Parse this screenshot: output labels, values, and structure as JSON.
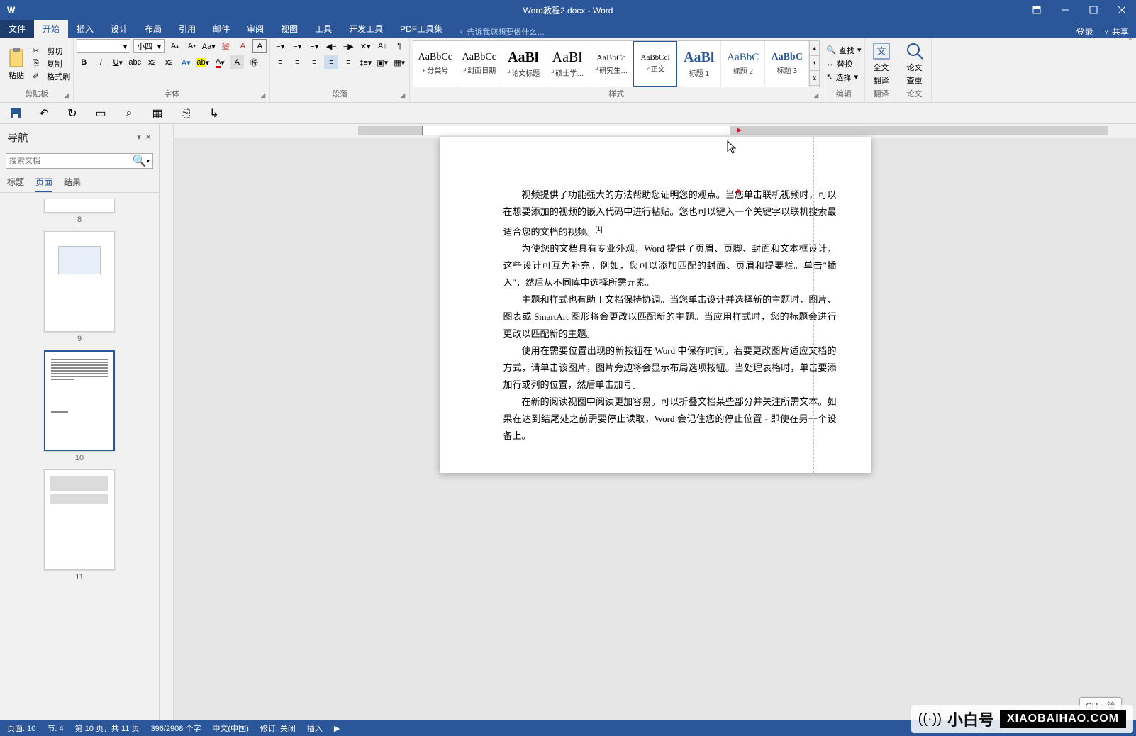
{
  "window": {
    "title": "Word教程2.docx - Word"
  },
  "titleControls": {
    "login": "登录",
    "share": "共享"
  },
  "tabs": {
    "file": "文件",
    "home": "开始",
    "insert": "插入",
    "design": "设计",
    "layout": "布局",
    "references": "引用",
    "mailings": "邮件",
    "review": "审阅",
    "view": "视图",
    "tools": "工具",
    "devtools": "开发工具",
    "pdftools": "PDF工具集",
    "tellme": "告诉我您想要做什么…"
  },
  "ribbon": {
    "clipboard": {
      "paste": "粘贴",
      "cut": "剪切",
      "copy": "复制",
      "formatPainter": "格式刷",
      "label": "剪贴板"
    },
    "font": {
      "name": "",
      "size": "小四",
      "label": "字体"
    },
    "paragraph": {
      "label": "段落"
    },
    "styles": {
      "label": "样式",
      "items": [
        {
          "preview": "AaBbCc",
          "label": "分类号",
          "arrow": true,
          "size": "14px"
        },
        {
          "preview": "AaBbCc",
          "label": "封面日期",
          "arrow": true,
          "size": "14px"
        },
        {
          "preview": "AaBl",
          "label": "论文标题",
          "arrow": true,
          "size": "20px",
          "bold": true
        },
        {
          "preview": "AaBl",
          "label": "硕士学…",
          "arrow": true,
          "size": "20px"
        },
        {
          "preview": "AaBbCc",
          "label": "研究生…",
          "arrow": true,
          "size": "12px"
        },
        {
          "preview": "AaBbCcI",
          "label": "正文",
          "arrow": true,
          "size": "11px",
          "selected": true
        },
        {
          "preview": "AaBl",
          "label": "标题 1",
          "arrow": false,
          "size": "20px",
          "bold": true,
          "color": "#2b579a"
        },
        {
          "preview": "AaBbC",
          "label": "标题 2",
          "arrow": false,
          "size": "15px",
          "color": "#2b579a"
        },
        {
          "preview": "AaBbC",
          "label": "标题 3",
          "arrow": false,
          "size": "14px",
          "bold": true,
          "color": "#2b579a"
        }
      ]
    },
    "editing": {
      "find": "查找",
      "replace": "替换",
      "select": "选择",
      "label": "编辑"
    },
    "translate": {
      "full": "全文",
      "line2": "翻译",
      "label": "翻译"
    },
    "duplicate": {
      "line1": "论文",
      "line2": "查重",
      "label": "论文"
    }
  },
  "nav": {
    "title": "导航",
    "searchPlaceholder": "搜索文档",
    "tabs": {
      "headings": "标题",
      "pages": "页面",
      "results": "结果"
    },
    "thumbs": [
      "8",
      "9",
      "10",
      "11"
    ]
  },
  "document": {
    "p1": "视频提供了功能强大的方法帮助您证明您的观点。当您单击联机视频时，可以在想要添加的视频的嵌入代码中进行粘贴。您也可以键入一个关键字以联机搜索最适合您的文档的视频。",
    "sup1": "[1]",
    "p2": "为使您的文档具有专业外观，Word 提供了页眉、页脚、封面和文本框设计，这些设计可互为补充。例如，您可以添加匹配的封面、页眉和提要栏。单击\"插入\"，然后从不同库中选择所需元素。",
    "p3": "主题和样式也有助于文档保持协调。当您单击设计并选择新的主题时，图片、图表或 SmartArt 图形将会更改以匹配新的主题。当应用样式时，您的标题会进行更改以匹配新的主题。",
    "p4": "使用在需要位置出现的新按钮在 Word 中保存时间。若要更改图片适应文档的方式，请单击该图片，图片旁边将会显示布局选项按钮。当处理表格时，单击要添加行或列的位置，然后单击加号。",
    "p5": "在新的阅读视图中阅读更加容易。可以折叠文档某些部分并关注所需文本。如果在达到结尾处之前需要停止读取，Word 会记住您的停止位置 - 即使在另一个设备上。"
  },
  "ime": {
    "text": "CH ♪ 简"
  },
  "brand": {
    "cn": "小白号",
    "url": "XIAOBAIHAO.COM"
  },
  "status": {
    "page": "页面: 10",
    "section": "节: 4",
    "pageOf": "第 10 页，共 11 页",
    "words": "396/2908 个字",
    "lang": "中文(中国)",
    "track": "修订: 关闭",
    "mode": "插入"
  }
}
